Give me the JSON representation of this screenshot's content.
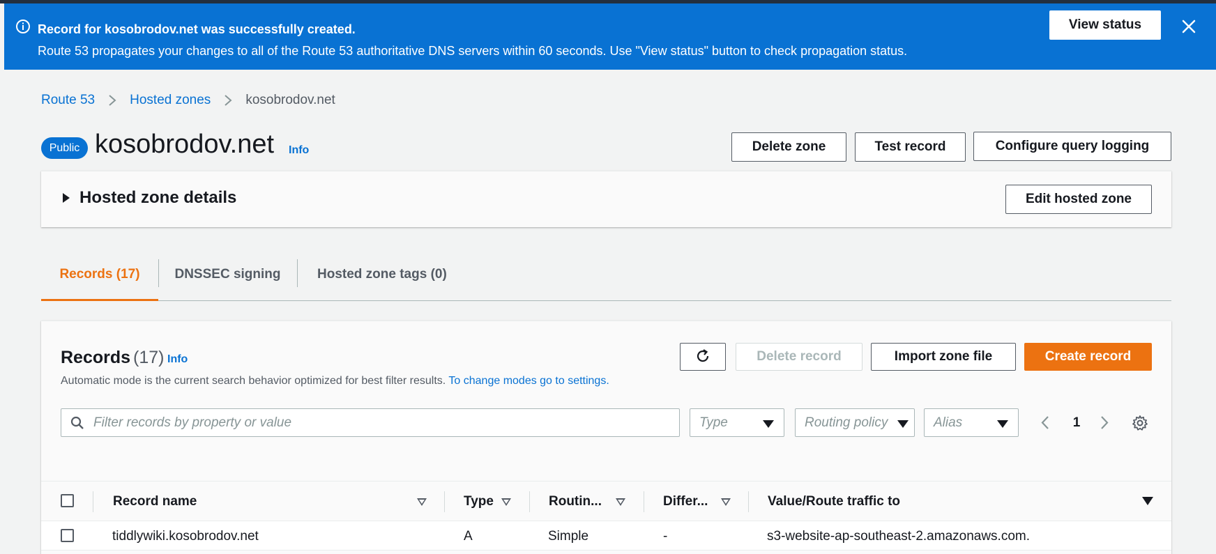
{
  "flash": {
    "title": "Record for kosobrodov.net was successfully created.",
    "message": "Route 53 propagates your changes to all of the Route 53 authoritative DNS servers within 60 seconds. Use \"View status\" button to check propagation status.",
    "view_status_label": "View status",
    "icons": {
      "info": "info-circle-icon",
      "close": "close-icon"
    }
  },
  "breadcrumb": {
    "items": [
      "Route 53",
      "Hosted zones",
      "kosobrodov.net"
    ]
  },
  "header": {
    "badge": "Public",
    "title": "kosobrodov.net",
    "info": "Info",
    "buttons": {
      "delete_zone": "Delete zone",
      "test_record": "Test record",
      "configure_logging": "Configure query logging"
    }
  },
  "details": {
    "title": "Hosted zone details",
    "edit_label": "Edit hosted zone"
  },
  "tabs": [
    {
      "label": "Records (17)",
      "active": true
    },
    {
      "label": "DNSSEC signing",
      "active": false
    },
    {
      "label": "Hosted zone tags (0)",
      "active": false
    }
  ],
  "records": {
    "title": "Records",
    "count": "(17)",
    "info": "Info",
    "description": "Automatic mode is the current search behavior optimized for best filter results.",
    "description_link": "To change modes go to settings.",
    "buttons": {
      "delete": "Delete record",
      "import": "Import zone file",
      "create": "Create record"
    },
    "filter_placeholder": "Filter records by property or value",
    "selects": {
      "type": "Type",
      "routing": "Routing policy",
      "alias": "Alias"
    },
    "page": "1",
    "columns": [
      "Record name",
      "Type",
      "Routin...",
      "Differ...",
      "Value/Route traffic to"
    ],
    "rows": [
      {
        "name": "tiddlywiki.kosobrodov.net",
        "type": "A",
        "routing": "Simple",
        "differentiator": "-",
        "value": "s3-website-ap-southeast-2.amazonaws.com."
      }
    ]
  },
  "colors": {
    "flash_bg": "#0972d3",
    "link": "#0972d3",
    "accent_orange": "#ec7211",
    "text": "#16191f"
  }
}
